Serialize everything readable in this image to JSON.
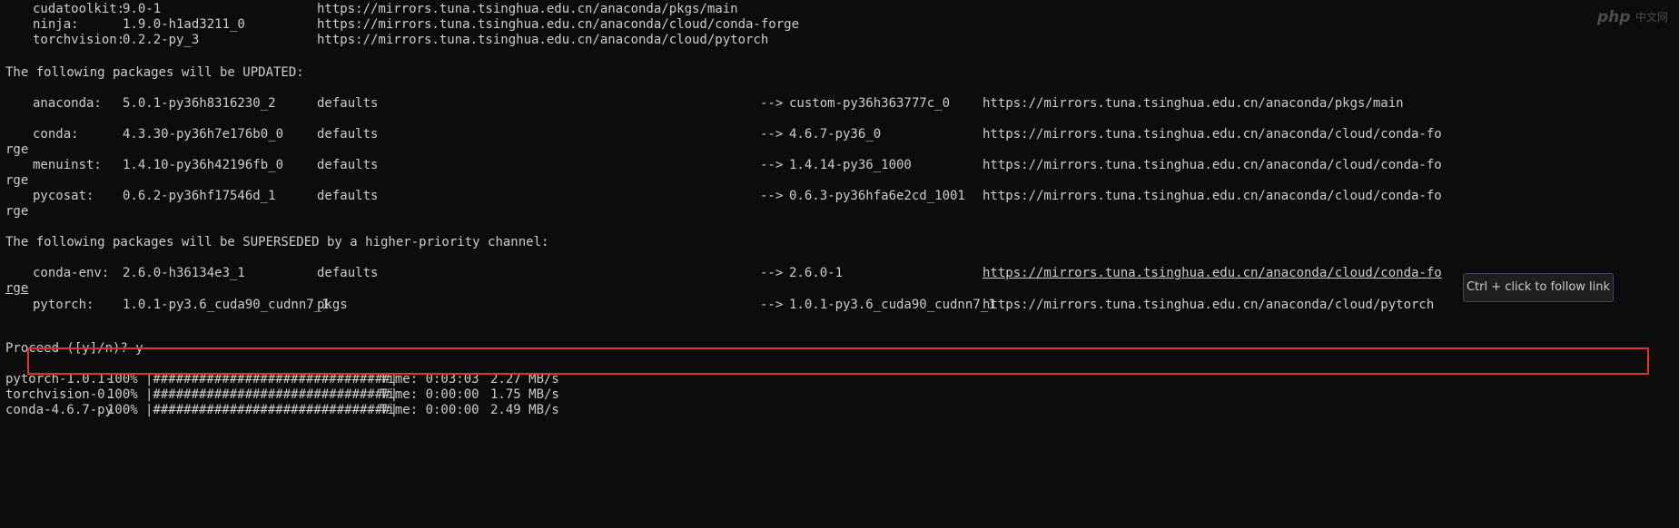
{
  "terminal": {
    "installs": [
      {
        "name": "cudatoolkit:",
        "version": "9.0-1",
        "channel": "https://mirrors.tuna.tsinghua.edu.cn/anaconda/pkgs/main"
      },
      {
        "name": "ninja:",
        "version": "1.9.0-h1ad3211_0",
        "channel": "https://mirrors.tuna.tsinghua.edu.cn/anaconda/cloud/conda-forge"
      },
      {
        "name": "torchvision:",
        "version": "0.2.2-py_3",
        "channel": "https://mirrors.tuna.tsinghua.edu.cn/anaconda/cloud/pytorch"
      }
    ],
    "updated_header": "The following packages will be UPDATED:",
    "updated": [
      {
        "name": "anaconda:",
        "version": "5.0.1-py36h8316230_2",
        "from": "defaults",
        "arrow": "-->",
        "to": "custom-py36h363777c_0",
        "channel": "https://mirrors.tuna.tsinghua.edu.cn/anaconda/pkgs/main",
        "wrap": ""
      },
      {
        "name": "conda:",
        "version": "4.3.30-py36h7e176b0_0",
        "from": "defaults",
        "arrow": "-->",
        "to": "4.6.7-py36_0",
        "channel": "https://mirrors.tuna.tsinghua.edu.cn/anaconda/cloud/conda-fo",
        "wrap": "rge"
      },
      {
        "name": "menuinst:",
        "version": "1.4.10-py36h42196fb_0",
        "from": "defaults",
        "arrow": "-->",
        "to": "1.4.14-py36_1000",
        "channel": "https://mirrors.tuna.tsinghua.edu.cn/anaconda/cloud/conda-fo",
        "wrap": "rge"
      },
      {
        "name": "pycosat:",
        "version": "0.6.2-py36hf17546d_1",
        "from": "defaults",
        "arrow": "-->",
        "to": "0.6.3-py36hfa6e2cd_1001",
        "channel": "https://mirrors.tuna.tsinghua.edu.cn/anaconda/cloud/conda-fo",
        "wrap": "rge"
      }
    ],
    "superseded_header": "The following packages will be SUPERSEDED by a higher-priority channel:",
    "superseded": [
      {
        "name": "conda-env:",
        "version": "2.6.0-h36134e3_1",
        "from": "defaults",
        "arrow": "-->",
        "to": "2.6.0-1",
        "channel": "https://mirrors.tuna.tsinghua.edu.cn/anaconda/cloud/conda-fo",
        "wrap": "rge"
      },
      {
        "name": "pytorch:",
        "version": "1.0.1-py3.6_cuda90_cudnn7_1",
        "from": "pkgs",
        "arrow": "-->",
        "to": "1.0.1-py3.6_cuda90_cudnn7_1",
        "channel": "https://mirrors.tuna.tsinghua.edu.cn/anaconda/cloud/pytorch",
        "wrap": ""
      }
    ],
    "prompt": "Proceed ([y]/n)? y",
    "downloads": [
      {
        "name": "pytorch-1.0.1-",
        "percent": "100%",
        "bar": "|###############################|",
        "time": "Time: 0:03:03",
        "speed": "2.27 MB/s"
      },
      {
        "name": "torchvision-0.",
        "percent": "100%",
        "bar": "|###############################|",
        "time": "Time: 0:00:00",
        "speed": "1.75 MB/s"
      },
      {
        "name": "conda-4.6.7-py",
        "percent": "100%",
        "bar": "|###############################|",
        "time": "Time: 0:00:00",
        "speed": "2.49 MB/s"
      }
    ]
  },
  "tooltip": {
    "text": "Ctrl + click to follow link"
  },
  "watermark": {
    "logo": "php",
    "suffix": "中文网"
  },
  "colors": {
    "background": "#0c0c0c",
    "text": "#cccccc",
    "highlight": "#e03030"
  }
}
